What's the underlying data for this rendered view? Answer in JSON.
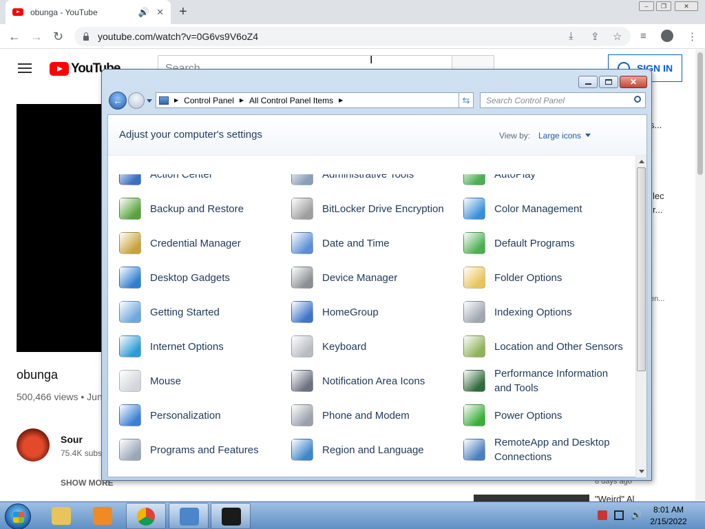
{
  "browser": {
    "tab_title": "obunga - YouTube",
    "url": "youtube.com/watch?v=0G6vs9V6oZ4",
    "new_tab_symbol": "+"
  },
  "youtube": {
    "logo_text": "YouTube",
    "search_placeholder": "Search",
    "sign_in": "SIGN IN",
    "video_title": "obunga",
    "views": "500,466 views • Jun",
    "channel_name": "Sour",
    "channel_subs": "75.4K subs",
    "show_more": "SHOW MORE",
    "sidebar_snippets": [
      "s...",
      "lec",
      "r...",
      "en...",
      "8 days ago",
      "\"Weird\" Al"
    ]
  },
  "control_panel": {
    "breadcrumb": [
      "Control Panel",
      "All Control Panel Items"
    ],
    "search_placeholder": "Search Control Panel",
    "heading": "Adjust your computer's settings",
    "view_by_label": "View by:",
    "view_by_value": "Large icons",
    "items": [
      {
        "label": "Action Center",
        "icon": "flag-icon",
        "color": "#3b6fc4"
      },
      {
        "label": "Administrative Tools",
        "icon": "admin-tools-icon",
        "color": "#8aa0b8"
      },
      {
        "label": "AutoPlay",
        "icon": "autoplay-icon",
        "color": "#4caf50"
      },
      {
        "label": "Backup and Restore",
        "icon": "backup-icon",
        "color": "#5aa33c"
      },
      {
        "label": "BitLocker Drive Encryption",
        "icon": "key-icon",
        "color": "#9e9e9e"
      },
      {
        "label": "Color Management",
        "icon": "color-management-icon",
        "color": "#3a8fd9"
      },
      {
        "label": "Credential Manager",
        "icon": "vault-icon",
        "color": "#c9a23a"
      },
      {
        "label": "Date and Time",
        "icon": "calendar-clock-icon",
        "color": "#5b8ed6"
      },
      {
        "label": "Default Programs",
        "icon": "default-programs-icon",
        "color": "#4caf50"
      },
      {
        "label": "Desktop Gadgets",
        "icon": "gadgets-icon",
        "color": "#2f7fd1"
      },
      {
        "label": "Device Manager",
        "icon": "device-manager-icon",
        "color": "#8c9096"
      },
      {
        "label": "Folder Options",
        "icon": "folder-icon",
        "color": "#e8c45a"
      },
      {
        "label": "Getting Started",
        "icon": "getting-started-icon",
        "color": "#6fa8dc"
      },
      {
        "label": "HomeGroup",
        "icon": "homegroup-icon",
        "color": "#3f74c9"
      },
      {
        "label": "Indexing Options",
        "icon": "indexing-icon",
        "color": "#a0a7b0"
      },
      {
        "label": "Internet Options",
        "icon": "globe-icon",
        "color": "#2e9bd6"
      },
      {
        "label": "Keyboard",
        "icon": "keyboard-icon",
        "color": "#b8bcc2"
      },
      {
        "label": "Location and Other Sensors",
        "icon": "sensors-icon",
        "color": "#8fb35a"
      },
      {
        "label": "Mouse",
        "icon": "mouse-icon",
        "color": "#d2d5da"
      },
      {
        "label": "Notification Area Icons",
        "icon": "notification-area-icon",
        "color": "#6b7280"
      },
      {
        "label": "Performance Information and Tools",
        "icon": "performance-icon",
        "color": "#2f6b3b"
      },
      {
        "label": "Personalization",
        "icon": "personalization-icon",
        "color": "#3c7fd4"
      },
      {
        "label": "Phone and Modem",
        "icon": "phone-icon",
        "color": "#9aa1aa"
      },
      {
        "label": "Power Options",
        "icon": "battery-icon",
        "color": "#3cae3c"
      },
      {
        "label": "Programs and Features",
        "icon": "programs-icon",
        "color": "#9aa7b8"
      },
      {
        "label": "Region and Language",
        "icon": "globe-clock-icon",
        "color": "#3e86c9"
      },
      {
        "label": "RemoteApp and Desktop Connections",
        "icon": "remoteapp-icon",
        "color": "#4a7fc0"
      }
    ]
  },
  "taskbar": {
    "apps": [
      {
        "name": "explorer-taskbar-button",
        "color": "#e8c45a"
      },
      {
        "name": "media-player-taskbar-button",
        "color": "#f08a24"
      },
      {
        "name": "chrome-taskbar-button",
        "color": "#db4437"
      },
      {
        "name": "control-panel-taskbar-button",
        "color": "#4a86c8"
      },
      {
        "name": "cmd-taskbar-button",
        "color": "#1a1a1a"
      }
    ],
    "time": "8:01 AM",
    "date": "2/15/2022"
  }
}
